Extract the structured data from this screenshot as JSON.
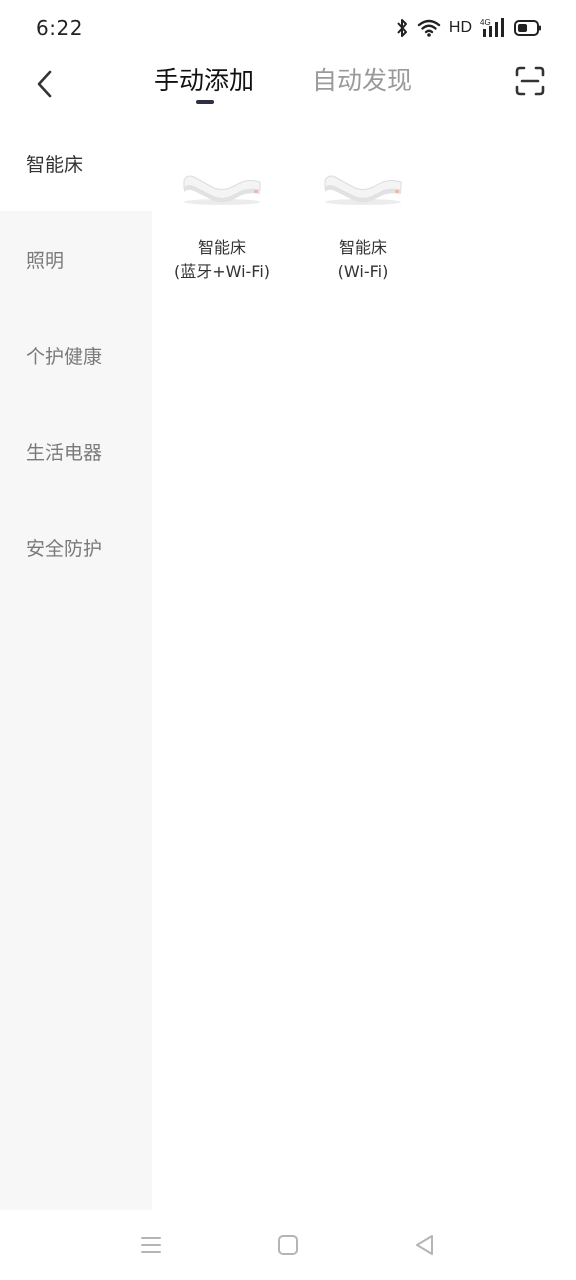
{
  "status_bar": {
    "time": "6:22",
    "network_label": "HD",
    "signal_label": "4G",
    "icons": [
      "bluetooth-icon",
      "wifi-icon",
      "signal-icon",
      "battery-icon"
    ]
  },
  "header": {
    "tabs": [
      {
        "label": "手动添加",
        "active": true
      },
      {
        "label": "自动发现",
        "active": false
      }
    ],
    "back_icon": "chevron-left-icon",
    "scan_icon": "scan-icon",
    "active_color": "#2d2f45"
  },
  "sidebar": {
    "items": [
      {
        "label": "智能床",
        "active": true
      },
      {
        "label": "照明",
        "active": false
      },
      {
        "label": "个护健康",
        "active": false
      },
      {
        "label": "生活电器",
        "active": false
      },
      {
        "label": "安全防护",
        "active": false
      }
    ]
  },
  "devices": [
    {
      "name_line1": "智能床",
      "name_line2": "(蓝牙+Wi-Fi)",
      "icon": "smart-bed-icon"
    },
    {
      "name_line1": "智能床",
      "name_line2": "(Wi-Fi)",
      "icon": "smart-bed-icon"
    }
  ],
  "nav_bar": {
    "icons": [
      "menu-icon",
      "home-icon",
      "back-triangle-icon"
    ]
  }
}
